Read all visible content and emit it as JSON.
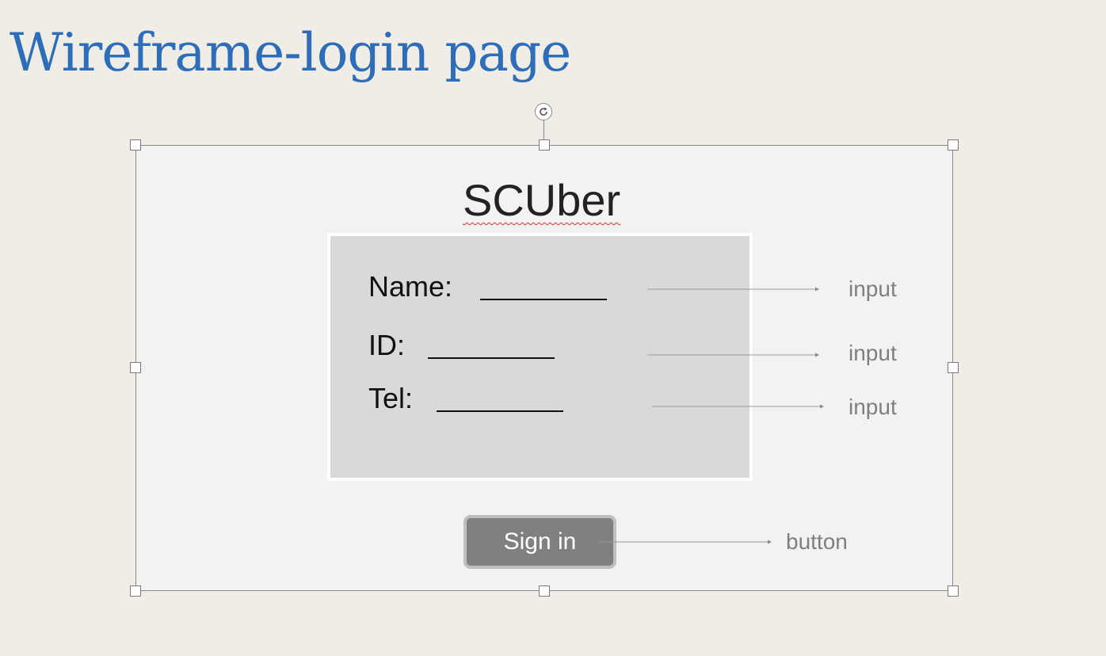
{
  "slide": {
    "title": "Wireframe-login page"
  },
  "wireframe": {
    "app_title": "SCUber",
    "fields": [
      {
        "label": "Name:",
        "annotation": "input"
      },
      {
        "label": "ID:",
        "annotation": "input"
      },
      {
        "label": "Tel:",
        "annotation": "input"
      }
    ],
    "button": {
      "label": "Sign in",
      "annotation": "button"
    }
  },
  "colors": {
    "slide_background": "#f0ede6",
    "title_blue": "#2e6eb8",
    "canvas": "#f2f2f2",
    "form_box": "#d9d9d9",
    "button_fill": "#808080",
    "button_border": "#bfbfbf",
    "annotation_gray": "#7f7f7f",
    "spellcheck_red": "#e03030"
  }
}
